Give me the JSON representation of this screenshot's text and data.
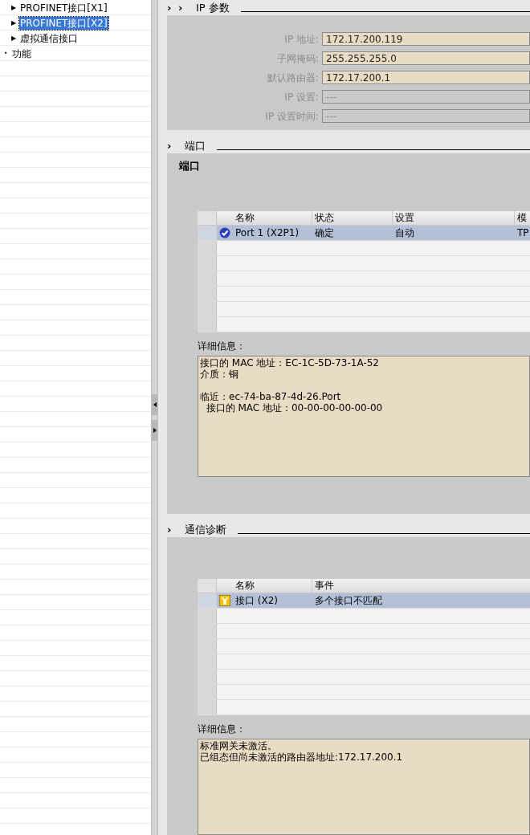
{
  "tree": [
    {
      "label": "PROFINET接口[X1]",
      "selected": false,
      "expander": "▶"
    },
    {
      "label": "PROFINET接口[X2]",
      "selected": true,
      "expander": "▶"
    },
    {
      "label": "虚拟通信接口",
      "selected": false,
      "expander": "▶"
    },
    {
      "label": "功能",
      "selected": false,
      "expander": "•",
      "top": true
    }
  ],
  "ip_section": {
    "title": "IP 参数",
    "chevrons": [
      "›",
      "›"
    ],
    "fields": [
      {
        "label": "IP 地址:",
        "value": "172.17.200.119",
        "disabled": false
      },
      {
        "label": "子网掩码:",
        "value": "255.255.255.0",
        "disabled": false
      },
      {
        "label": "默认路由器:",
        "value": "172.17.200.1",
        "disabled": false
      },
      {
        "label": "IP 设置:",
        "placeholder": "---",
        "disabled": true
      },
      {
        "label": "IP 设置时间:",
        "placeholder": "---",
        "disabled": true
      }
    ]
  },
  "port_section": {
    "title": "端口",
    "chevrons": [
      "›"
    ],
    "panel_title": "端口",
    "table": {
      "columns": [
        "名称",
        "状态",
        "设置",
        "模"
      ],
      "rows": [
        {
          "kind": "ok",
          "selected": true,
          "cells": [
            "Port 1 (X2P1)",
            "确定",
            "自动",
            "TP"
          ]
        }
      ]
    },
    "details_label": "详细信息：",
    "details": [
      [
        "接口的 MAC 地址：EC-1C-5D-73-1A-52",
        "介质：铜"
      ],
      [
        "临近：ec-74-ba-87-4d-26.Port",
        "  接口的 MAC 地址：00-00-00-00-00-00"
      ]
    ]
  },
  "diag_section": {
    "title": "通信诊断",
    "chevrons": [
      "›"
    ],
    "table": {
      "columns": [
        "名称",
        "事件"
      ],
      "rows": [
        {
          "kind": "maintenance",
          "selected": true,
          "cells": [
            "接口 (X2)",
            "多个接口不匹配"
          ]
        }
      ]
    },
    "details_label": "详细信息：",
    "details": [
      [
        "标准网关未激活。",
        "已组态但尚未激活的路由器地址:172.17.200.1"
      ]
    ]
  }
}
